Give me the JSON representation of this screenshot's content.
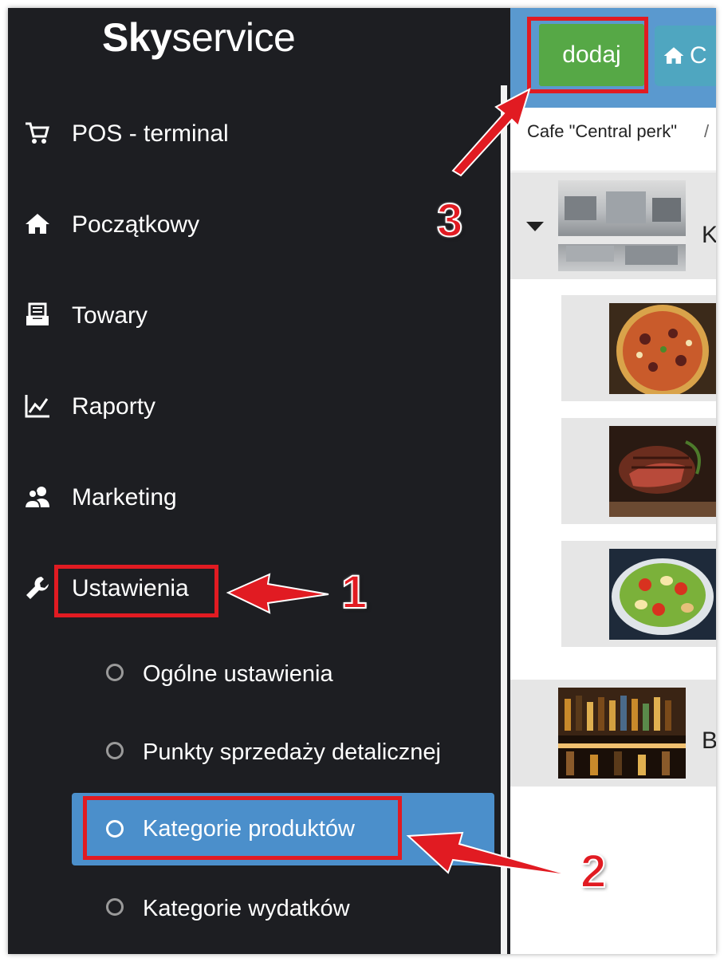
{
  "sidebar": {
    "logo": {
      "bold": "Sky",
      "light": "service"
    },
    "nav": [
      {
        "label": "POS - terminal",
        "icon": "cart-icon"
      },
      {
        "label": "Początkowy",
        "icon": "home-icon"
      },
      {
        "label": "Towary",
        "icon": "inbox-icon"
      },
      {
        "label": "Raporty",
        "icon": "chart-icon"
      },
      {
        "label": "Marketing",
        "icon": "users-icon"
      },
      {
        "label": "Ustawienia",
        "icon": "wrench-icon"
      }
    ],
    "settings_sub": [
      {
        "label": "Ogólne ustawienia",
        "active": false
      },
      {
        "label": "Punkty sprzedaży detalicznej",
        "active": false
      },
      {
        "label": "Kategorie produktów",
        "active": true
      },
      {
        "label": "Kategorie wydatków",
        "active": false
      }
    ]
  },
  "toolbar": {
    "add_label": "dodaj",
    "home_label": "C"
  },
  "breadcrumb": {
    "place": "Cafe \"Central perk\"",
    "separator": "/"
  },
  "categories": [
    {
      "letter": "K",
      "icon": "kitchen-photo",
      "children": [
        "pizza-photo",
        "steak-photo",
        "salad-photo"
      ]
    },
    {
      "letter": "B",
      "icon": "bar-photo",
      "children": []
    }
  ],
  "annotations": {
    "step1": "1",
    "step2": "2",
    "step3": "3",
    "color": "#e11b22"
  },
  "colors": {
    "sidebar_bg": "#1d1e22",
    "active_bg": "#4b8fcb",
    "topbar_bg": "#5a99cf",
    "add_btn": "#56a846",
    "home_btn": "#4fa6c0",
    "row_bg": "#e6e6e6"
  }
}
